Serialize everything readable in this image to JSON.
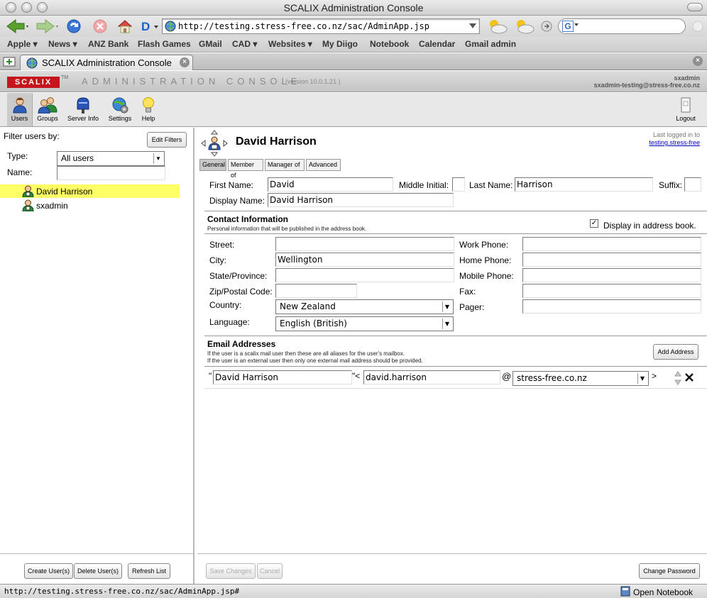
{
  "browser": {
    "window_title": "SCALIX Administration Console",
    "url": "http://testing.stress-free.co.nz/sac/AdminApp.jsp",
    "search_engine_glyph": "G",
    "bookmarks": [
      "Apple ▾",
      "News ▾",
      "ANZ Bank",
      "Flash Games",
      "GMail",
      "CAD ▾",
      "Websites ▾",
      "My Diigo",
      "Notebook",
      "Calendar",
      "Gmail admin"
    ],
    "tab_title": "SCALIX Administration Console",
    "status_url": "http://testing.stress-free.co.nz/sac/AdminApp.jsp#",
    "status_right": "Open Notebook"
  },
  "app": {
    "logo": "SCALIX",
    "trademark": "TM",
    "title": "ADMINISTRATION CONSOLE",
    "version": "(version 10.0.1.21 )",
    "user_name": "sxadmin",
    "user_email": "sxadmin-testing@stress-free.co.nz",
    "colors": {
      "brand_red": "#c4161c",
      "selection_yellow": "#ffff66",
      "link_blue": "#0000cc"
    }
  },
  "toolbar": {
    "items": [
      {
        "label": "Users",
        "icon": "users-icon"
      },
      {
        "label": "Groups",
        "icon": "groups-icon"
      },
      {
        "label": "Server Info",
        "icon": "mailbox-icon"
      },
      {
        "label": "Settings",
        "icon": "settings-globe-icon"
      },
      {
        "label": "Help",
        "icon": "lightbulb-icon"
      }
    ],
    "logout": "Logout"
  },
  "left": {
    "filter_label": "Filter users by:",
    "edit_filters": "Edit Filters",
    "type_label": "Type:",
    "type_value": "All users",
    "name_label": "Name:",
    "name_value": "",
    "users": [
      "David Harrison",
      "sxadmin"
    ],
    "buttons": {
      "create": "Create User(s)",
      "delete": "Delete User(s)",
      "refresh": "Refresh List"
    }
  },
  "right": {
    "header_name": "David Harrison",
    "last_logged": "Last logged in to",
    "last_logged_host": "testing.stress-free",
    "tabs": [
      "General",
      "Member of",
      "Manager of",
      "Advanced"
    ],
    "name": {
      "first_label": "First Name:",
      "first": "David",
      "middle_label": "Middle Initial:",
      "middle": "",
      "last_label": "Last Name:",
      "last": "Harrison",
      "suffix_label": "Suffix:",
      "suffix": "",
      "display_label": "Display Name:",
      "display": "David Harrison"
    },
    "contact": {
      "title": "Contact Information",
      "desc": "Personal information that will be published in the address book.",
      "address_book_check": "✓",
      "address_book_label": "Display in address book.",
      "street_label": "Street:",
      "street": "",
      "city_label": "City:",
      "city": "Wellington",
      "state_label": "State/Province:",
      "state": "",
      "zip_label": "Zip/Postal Code:",
      "zip": "",
      "country_label": "Country:",
      "country": "New Zealand",
      "language_label": "Language:",
      "language": "English (British)",
      "work_label": "Work Phone:",
      "work": "",
      "home_label": "Home Phone:",
      "home": "",
      "mobile_label": "Mobile Phone:",
      "mobile": "",
      "fax_label": "Fax:",
      "fax": "",
      "pager_label": "Pager:",
      "pager": ""
    },
    "email": {
      "title": "Email Addresses",
      "desc1": "If the user is a scalix mail user then these are all aliases for the user's mailbox.",
      "desc2": "If the user is an external user then only one external mail address should be provided.",
      "add_button": "Add Address",
      "quote_open": "\"",
      "quote_close": "\"<",
      "at": "@",
      "gt": ">",
      "display_name": "David Harrison",
      "local_part": "david.harrison",
      "domain": "stress-free.co.nz"
    },
    "buttons": {
      "save": "Save Changes",
      "cancel": "Cancel",
      "change_password": "Change Password"
    }
  }
}
